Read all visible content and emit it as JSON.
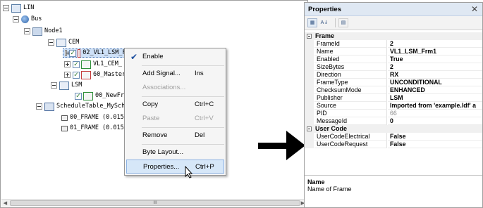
{
  "tree": {
    "items": [
      {
        "label": "LIN",
        "icon": "lin-icon"
      },
      {
        "label": "Bus",
        "icon": "bus-icon"
      },
      {
        "label": "Node1",
        "icon": "node-icon"
      },
      {
        "label": "CEM",
        "icon": "ecu-icon"
      },
      {
        "label": "02_VL1_LSM_Frm1",
        "icon": "frame-icon",
        "checked": true
      },
      {
        "label": "VL1_CEM_",
        "icon": "frame-icon",
        "checked": true
      },
      {
        "label": "60_Master",
        "icon": "frame-icon",
        "checked": true
      },
      {
        "label": "LSM",
        "icon": "ecu-icon"
      },
      {
        "label": "00_NewFra",
        "icon": "frame-icon",
        "checked": true
      },
      {
        "label": "ScheduleTable_MySche",
        "icon": "schedule-table-icon"
      },
      {
        "label": "00_FRAME (0.015s",
        "icon": "slot-icon"
      },
      {
        "label": "01_FRAME (0.015s",
        "icon": "slot-icon"
      }
    ],
    "scroll_thumb_label": "III"
  },
  "context_menu": {
    "enable": "Enable",
    "add_signal": "Add Signal...",
    "add_signal_shortcut": "Ins",
    "associations": "Associations...",
    "copy": "Copy",
    "copy_shortcut": "Ctrl+C",
    "paste": "Paste",
    "paste_shortcut": "Ctrl+V",
    "remove": "Remove",
    "remove_shortcut": "Del",
    "byte_layout": "Byte Layout...",
    "properties": "Properties...",
    "properties_shortcut": "Ctrl+P"
  },
  "properties": {
    "title": "Properties",
    "categories": {
      "frame": "Frame",
      "user_code": "User Code"
    },
    "frame_rows": [
      {
        "name": "FrameId",
        "value": "2"
      },
      {
        "name": "Name",
        "value": "VL1_LSM_Frm1"
      },
      {
        "name": "Enabled",
        "value": "True"
      },
      {
        "name": "SizeBytes",
        "value": "2"
      },
      {
        "name": "Direction",
        "value": "RX"
      },
      {
        "name": "FrameType",
        "value": "UNCONDITIONAL"
      },
      {
        "name": "ChecksumMode",
        "value": "ENHANCED"
      },
      {
        "name": "Publisher",
        "value": "LSM"
      },
      {
        "name": "Source",
        "value": "Imported from 'example.ldf' a"
      },
      {
        "name": "PID",
        "value": "66",
        "readonly": true
      },
      {
        "name": "MessageId",
        "value": "0"
      }
    ],
    "user_code_rows": [
      {
        "name": "UserCodeElectrical",
        "value": "False"
      },
      {
        "name": "UserCodeRequest",
        "value": "False"
      }
    ],
    "description": {
      "title": "Name",
      "text": "Name of Frame"
    }
  },
  "colors": {
    "selection": "#cde0f7",
    "menu_hover": "#d6e7f8",
    "panel_title": "#dfe8f3"
  }
}
